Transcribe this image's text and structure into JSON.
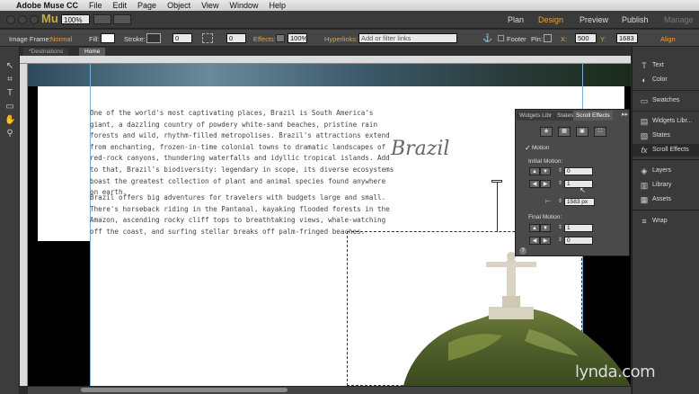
{
  "menubar": {
    "apple": "",
    "app": "Adobe Muse CC",
    "items": [
      "File",
      "Edit",
      "Page",
      "Object",
      "View",
      "Window",
      "Help"
    ]
  },
  "apptop": {
    "logo": "Mu",
    "zoom": "100%",
    "modes": [
      "Plan",
      "Design",
      "Preview",
      "Publish",
      "Manage"
    ],
    "active_mode": "Design"
  },
  "options": {
    "image_frame_label": "Image Frame:",
    "image_frame_value": "Normal",
    "fill_label": "Fill:",
    "stroke_label": "Stroke:",
    "stroke_value": "0",
    "corner_value": "0",
    "effects_label": "Effects:",
    "opacity_value": "100%",
    "hyperlinks_label": "Hyperlinks:",
    "hyperlinks_placeholder": "Add or filter links",
    "footer_label": "Footer",
    "pin_label": "Pin:",
    "x_label": "X:",
    "x_value": "500",
    "y_label": "Y:",
    "y_value": "1683",
    "align_label": "Align"
  },
  "tabs": [
    "*Destinations",
    "Home"
  ],
  "page": {
    "paragraph1": "One of the world's most captivating places, Brazil is South America's giant, a dazzling country of powdery white-sand beaches, pristine rain forests and wild, rhythm-filled metropolises. Brazil's attractions extend from enchanting, frozen-in-time colonial towns to dramatic landscapes of red-rock canyons, thundering waterfalls and idyllic tropical islands. Add to that, Brazil's biodiversity: legendary in scope, its diverse ecosystems boast the greatest collection of plant and animal species found anywhere on earth.",
    "paragraph2": "Brazil offers big adventures for travelers with budgets large and small. There's horseback riding in the Pantanal, kayaking flooded forests in the Amazon, ascending rocky cliff tops to breathtaking views, whale-watching off the coast, and surfing stellar breaks off palm-fringed beaches.",
    "title": "Brazil"
  },
  "scroll_panel": {
    "tabs": [
      "Widgets Libr",
      "States",
      "Scroll Effects"
    ],
    "active_tab": "Scroll Effects",
    "motion_label": "Motion",
    "motion_checked": true,
    "initial_motion_label": "Initial Motion:",
    "initial_v_value": "0",
    "initial_h_value": "1",
    "key_position": "1583 px",
    "final_motion_label": "Final Motion:",
    "final_v_value": "1",
    "final_h_value": "0"
  },
  "dock": {
    "items": [
      {
        "icon": "T",
        "label": "Text"
      },
      {
        "icon": "◐",
        "label": "Color"
      },
      {
        "icon": "▭",
        "label": "Swatches"
      },
      {
        "icon": "▤",
        "label": "Widgets Libr..."
      },
      {
        "icon": "▧",
        "label": "States"
      },
      {
        "icon": "fx",
        "label": "Scroll Effects"
      },
      {
        "icon": "◈",
        "label": "Layers"
      },
      {
        "icon": "▥",
        "label": "Library"
      },
      {
        "icon": "▦",
        "label": "Assets"
      },
      {
        "icon": "≡",
        "label": "Wrap"
      }
    ],
    "selected": "Scroll Effects"
  },
  "watermark": "lynda.com",
  "colors": {
    "accent": "#e6a13e",
    "panel": "#4a4a4a",
    "chrome": "#3a3a3a"
  }
}
